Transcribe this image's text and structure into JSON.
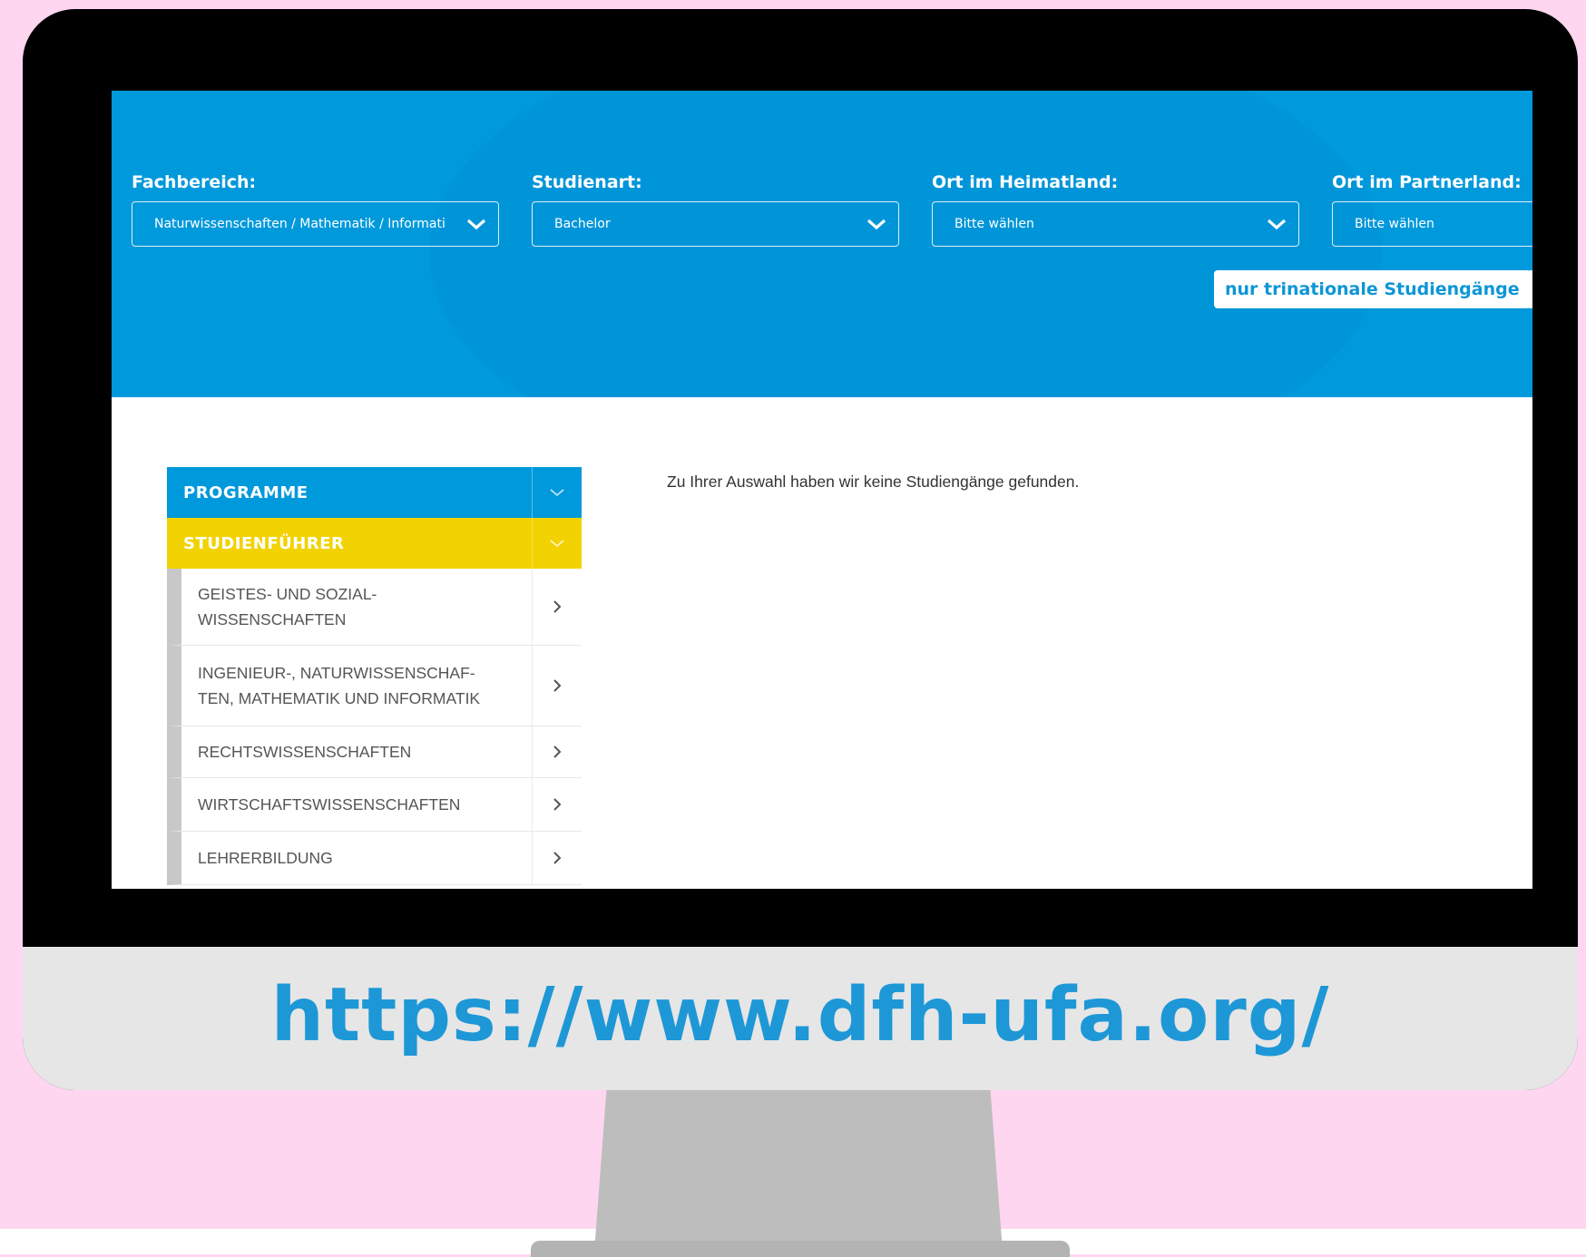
{
  "colors": {
    "background": "#ffd6f0",
    "brand_blue": "#0099dc",
    "accent_yellow": "#f2d200",
    "url_text": "#1e97d6"
  },
  "filters": [
    {
      "label": "Fachbereich:",
      "value": "Naturwissenschaften / Mathematik / Informati"
    },
    {
      "label": "Studienart:",
      "value": "Bachelor"
    },
    {
      "label": "Ort im Heimatland:",
      "value": "Bitte wählen"
    },
    {
      "label": "Ort im Partnerland:",
      "value": "Bitte wählen"
    }
  ],
  "trinational_button": "nur trinationale Studiengänge",
  "sidebar": {
    "programme": "PROGRAMME",
    "studienfuehrer": "STUDIENFÜHRER",
    "items": [
      {
        "label": "GEISTES- UND SOZIAL-\nWISSENSCHAFTEN"
      },
      {
        "label": "INGENIEUR-, NATURWISSENSCHAF-\nTEN, MATHEMATIK UND INFORMATIK"
      },
      {
        "label": "RECHTSWISSENSCHAFTEN"
      },
      {
        "label": "WIRTSCHAFTSWISSENSCHAFTEN"
      },
      {
        "label": "LEHRERBILDUNG"
      }
    ]
  },
  "result_message": "Zu Ihrer Auswahl haben wir keine Studiengänge gefunden.",
  "url_caption": "https://www.dfh-ufa.org/"
}
